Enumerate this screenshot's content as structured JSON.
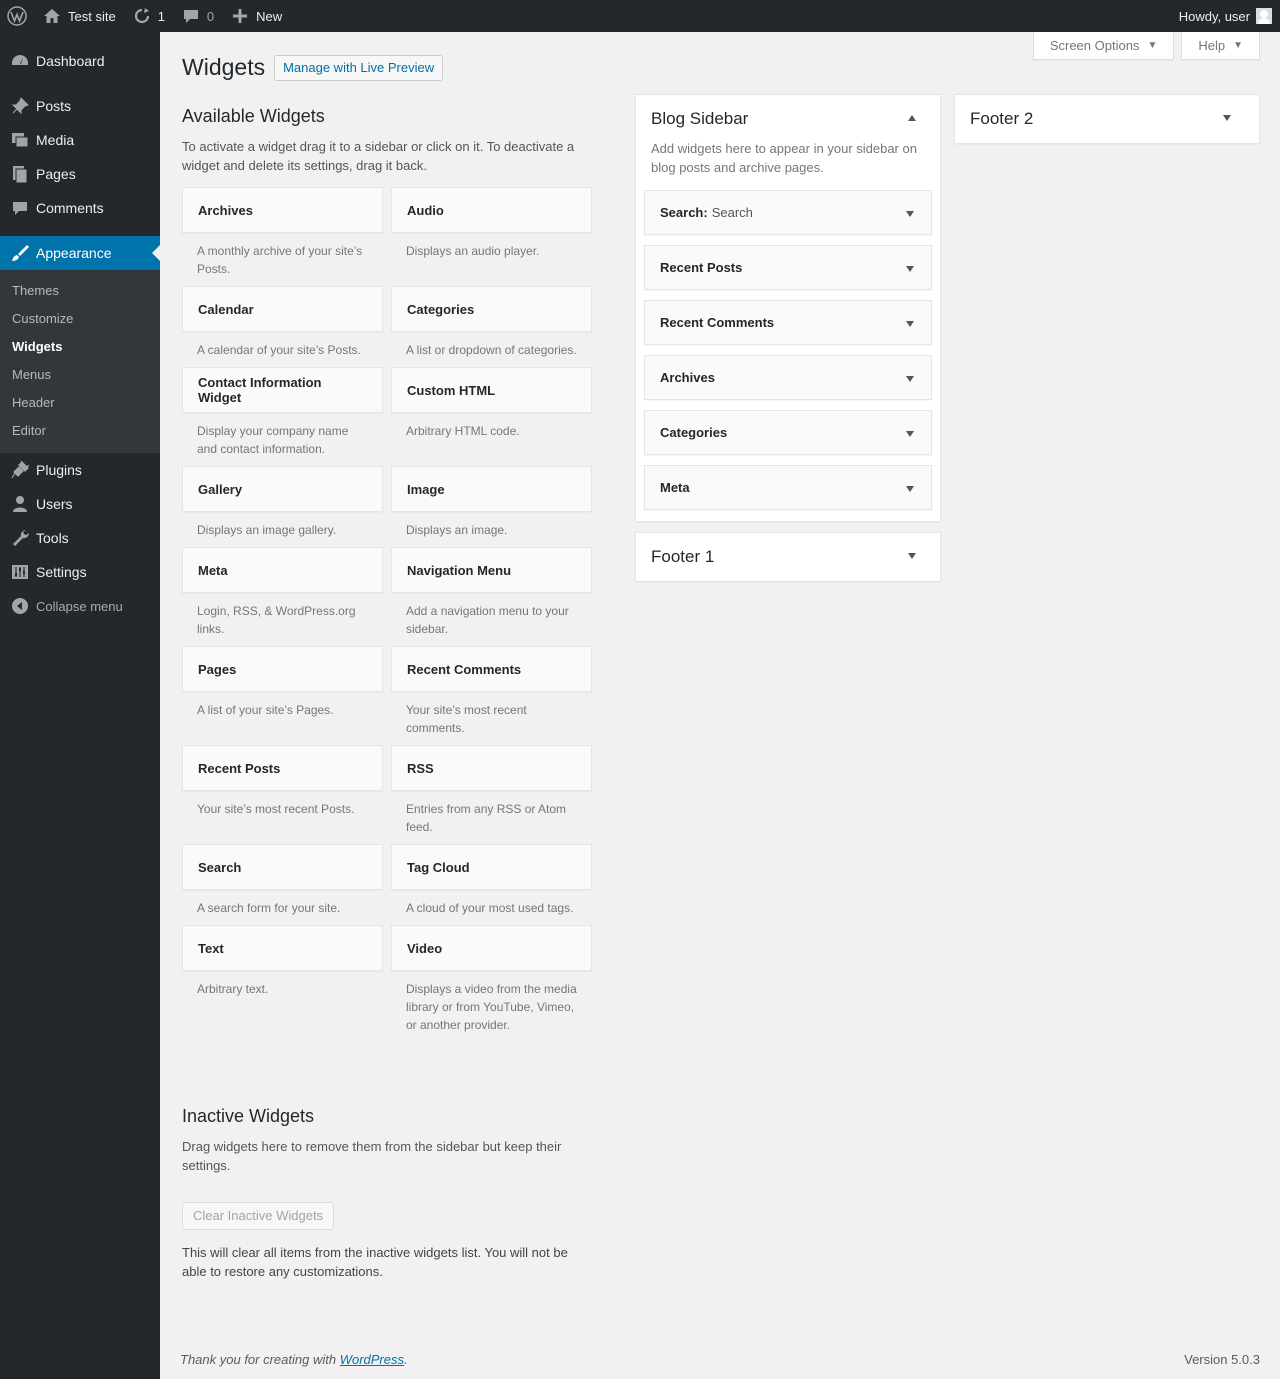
{
  "adminbar": {
    "site_name": "Test site",
    "updates_count": "1",
    "comments_count": "0",
    "new_label": "New",
    "howdy": "Howdy, user"
  },
  "menu": {
    "dashboard": "Dashboard",
    "posts": "Posts",
    "media": "Media",
    "pages": "Pages",
    "comments": "Comments",
    "appearance": "Appearance",
    "submenu": [
      "Themes",
      "Customize",
      "Widgets",
      "Menus",
      "Header",
      "Editor"
    ],
    "plugins": "Plugins",
    "users": "Users",
    "tools": "Tools",
    "settings": "Settings",
    "collapse": "Collapse menu"
  },
  "screen_options": "Screen Options",
  "help": "Help",
  "page": {
    "title": "Widgets",
    "live_preview": "Manage with Live Preview"
  },
  "available": {
    "title": "Available Widgets",
    "desc": "To activate a widget drag it to a sidebar or click on it. To deactivate a widget and delete its settings, drag it back.",
    "widgets": [
      {
        "title": "Archives",
        "desc": "A monthly archive of your site’s Posts."
      },
      {
        "title": "Audio",
        "desc": "Displays an audio player."
      },
      {
        "title": "Calendar",
        "desc": "A calendar of your site’s Posts."
      },
      {
        "title": "Categories",
        "desc": "A list or dropdown of categories."
      },
      {
        "title": "Contact Information Widget",
        "desc": "Display your company name and contact information."
      },
      {
        "title": "Custom HTML",
        "desc": "Arbitrary HTML code."
      },
      {
        "title": "Gallery",
        "desc": "Displays an image gallery."
      },
      {
        "title": "Image",
        "desc": "Displays an image."
      },
      {
        "title": "Meta",
        "desc": "Login, RSS, & WordPress.org links."
      },
      {
        "title": "Navigation Menu",
        "desc": "Add a navigation menu to your sidebar."
      },
      {
        "title": "Pages",
        "desc": "A list of your site’s Pages."
      },
      {
        "title": "Recent Comments",
        "desc": "Your site’s most recent comments."
      },
      {
        "title": "Recent Posts",
        "desc": "Your site’s most recent Posts."
      },
      {
        "title": "RSS",
        "desc": "Entries from any RSS or Atom feed."
      },
      {
        "title": "Search",
        "desc": "A search form for your site."
      },
      {
        "title": "Tag Cloud",
        "desc": "A cloud of your most used tags."
      },
      {
        "title": "Text",
        "desc": "Arbitrary text."
      },
      {
        "title": "Video",
        "desc": "Displays a video from the media library or from YouTube, Vimeo, or another provider."
      }
    ]
  },
  "inactive": {
    "title": "Inactive Widgets",
    "desc": "Drag widgets here to remove them from the sidebar but keep their settings.",
    "clear_btn": "Clear Inactive Widgets",
    "note": "This will clear all items from the inactive widgets list. You will not be able to restore any customizations."
  },
  "blog_sidebar": {
    "title": "Blog Sidebar",
    "desc": "Add widgets here to appear in your sidebar on blog posts and archive pages.",
    "widgets": [
      {
        "title": "Search",
        "in_title": "Search"
      },
      {
        "title": "Recent Posts",
        "in_title": ""
      },
      {
        "title": "Recent Comments",
        "in_title": ""
      },
      {
        "title": "Archives",
        "in_title": ""
      },
      {
        "title": "Categories",
        "in_title": ""
      },
      {
        "title": "Meta",
        "in_title": ""
      }
    ]
  },
  "footer1": {
    "title": "Footer 1"
  },
  "footer2": {
    "title": "Footer 2"
  },
  "footer": {
    "thanks_prefix": "Thank you for creating with ",
    "thanks_link": "WordPress",
    "thanks_suffix": ".",
    "version": "Version 5.0.3"
  },
  "colors": {
    "adminbar_bg": "#23282d",
    "menu_current": "#0073aa",
    "link": "#0073aa"
  }
}
